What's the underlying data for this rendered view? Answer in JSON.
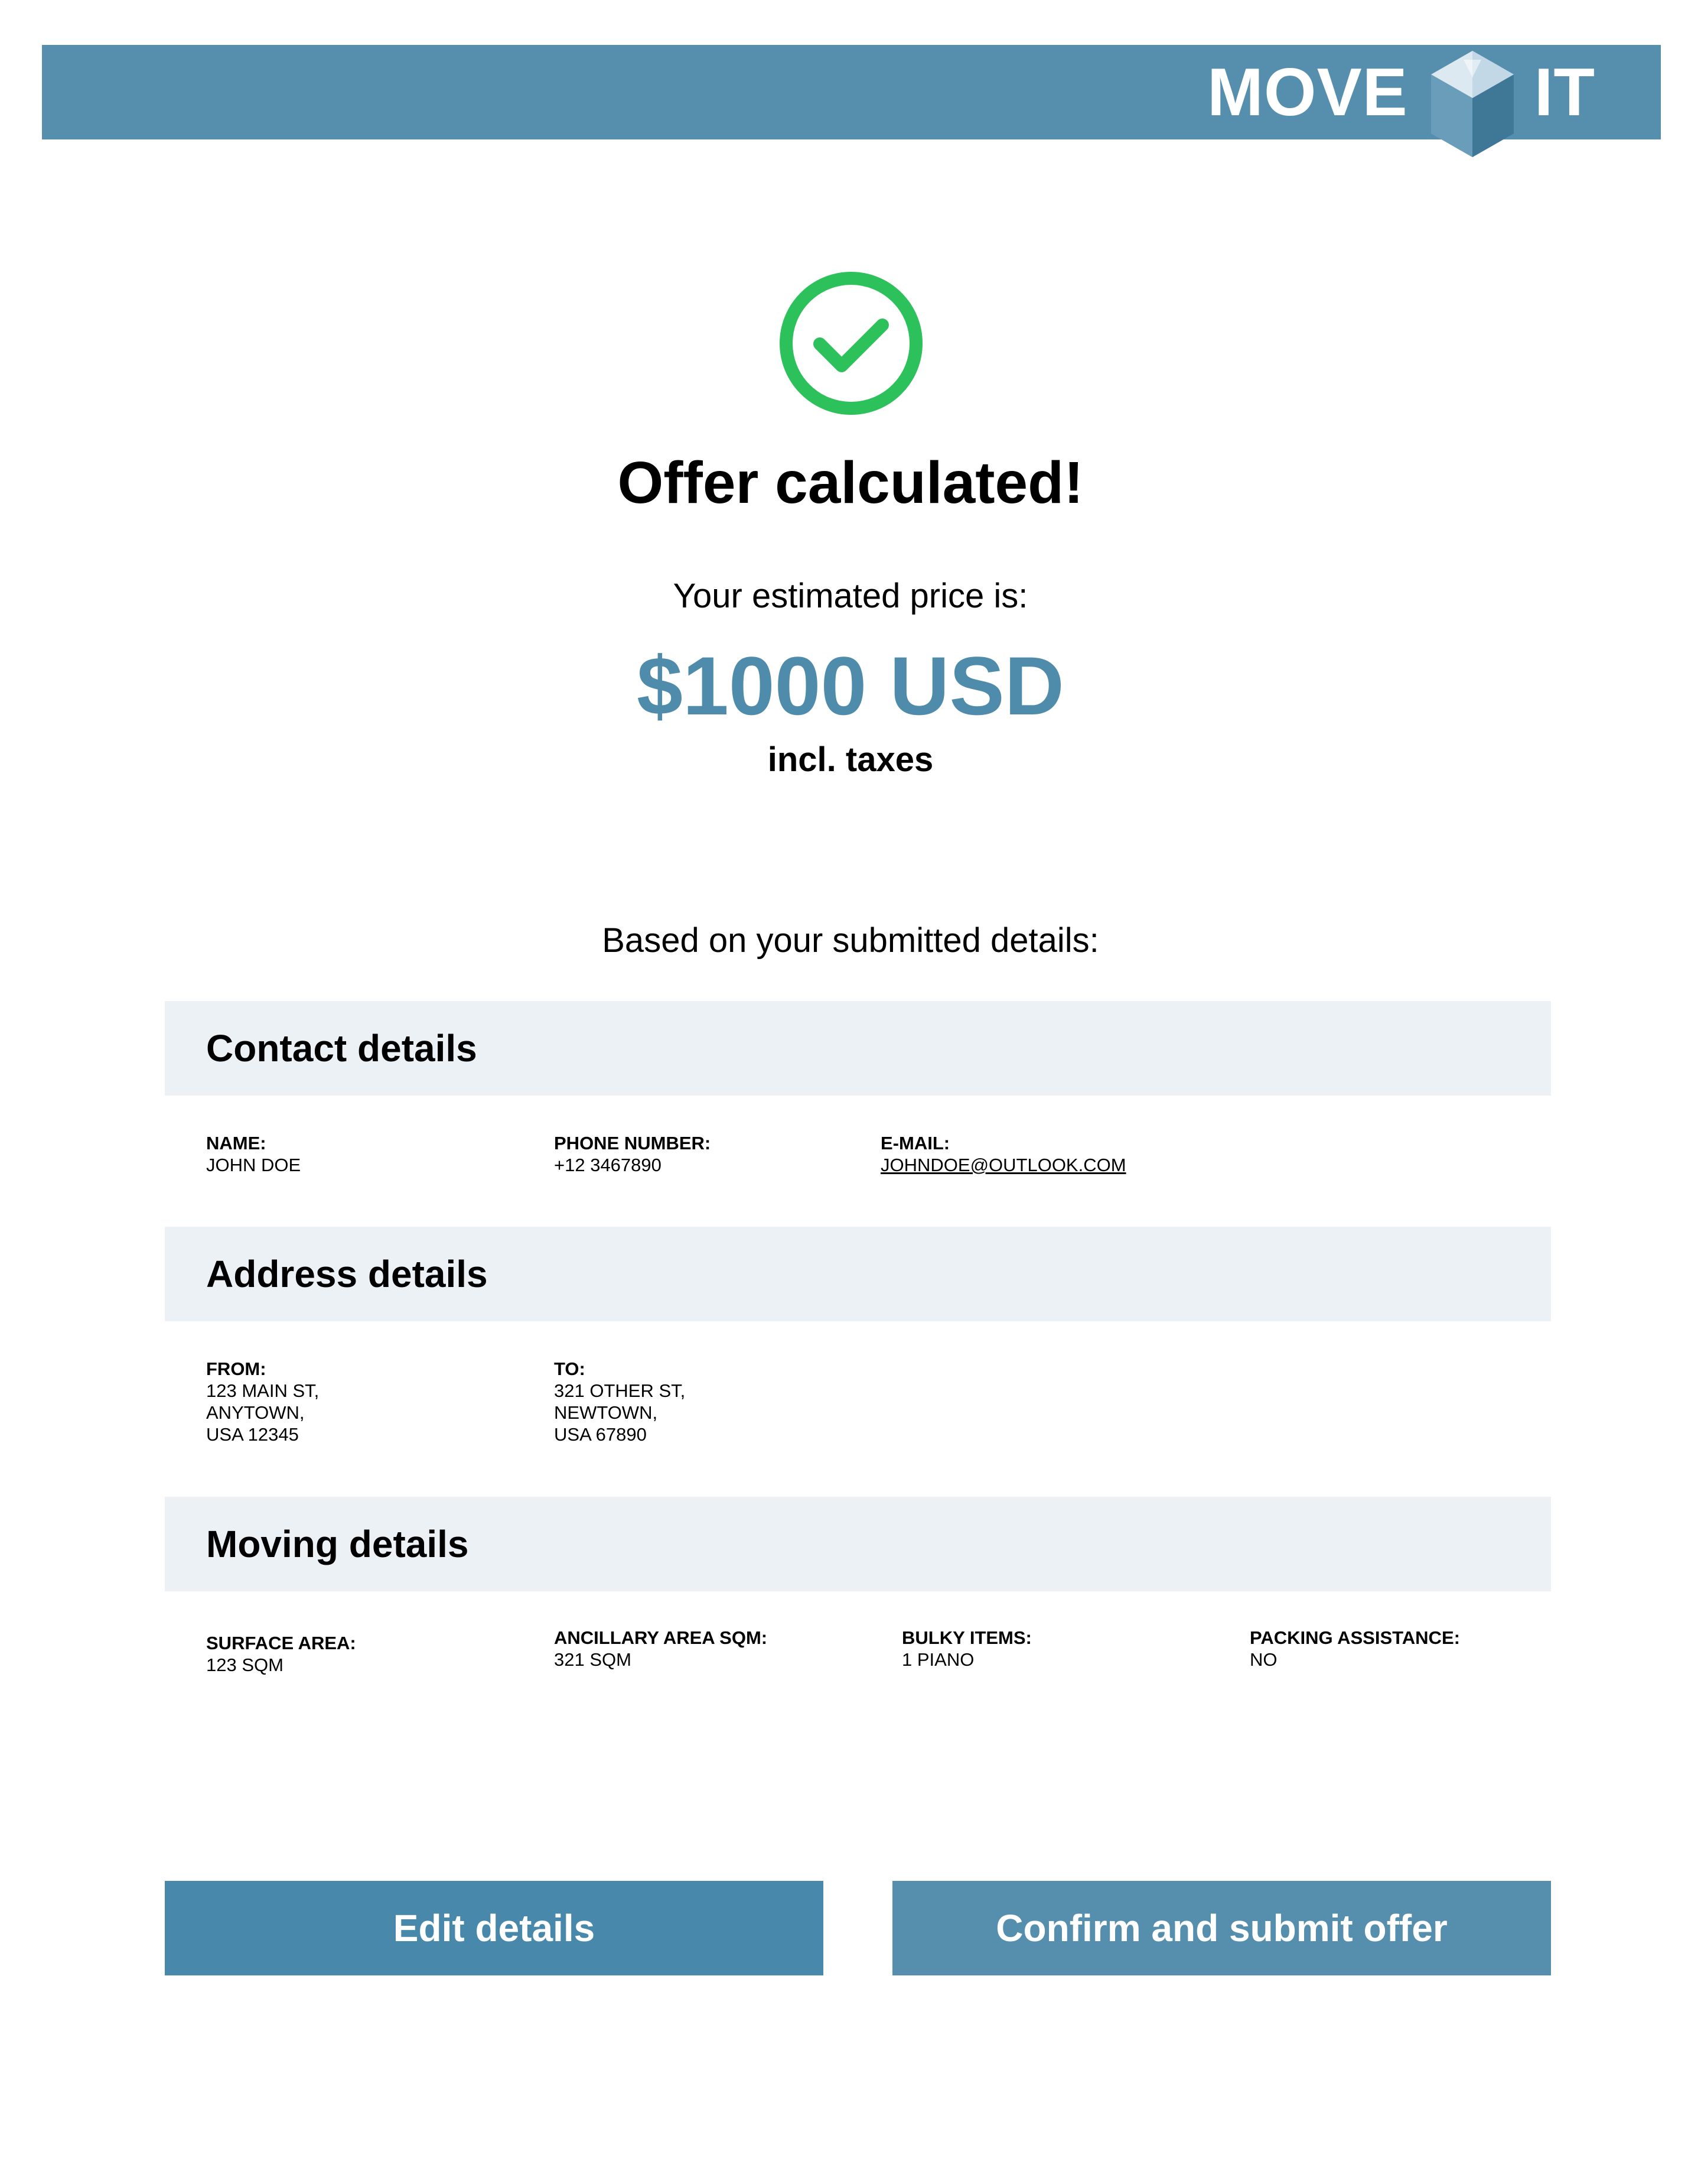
{
  "colors": {
    "brand": "#568fae",
    "price": "#4f8bab",
    "success": "#2dc15b",
    "section_bg": "#ecf1f5"
  },
  "header": {
    "logo_left": "MOVE",
    "logo_right": "IT",
    "logo_icon": "cube-icon"
  },
  "status": {
    "icon": "check-circle-icon",
    "title": "Offer calculated!",
    "subtitle": "Your estimated price is:",
    "price": "$1000 USD",
    "tax_note": "incl. taxes",
    "based_on": "Based on your submitted details:"
  },
  "contact": {
    "heading": "Contact details",
    "name_label": "NAME:",
    "name_value": "JOHN DOE",
    "phone_label": "PHONE NUMBER:",
    "phone_value": "+12 3467890",
    "email_label": "E-MAIL:",
    "email_value": "JOHNDOE@OUTLOOK.COM"
  },
  "address": {
    "heading": "Address details",
    "from_label": "FROM:",
    "from_value": "123 MAIN ST,\nANYTOWN,\nUSA 12345",
    "to_label": "TO:",
    "to_value": "321 OTHER ST,\nNEWTOWN,\nUSA 67890"
  },
  "moving": {
    "heading": "Moving details",
    "surface_label": "SURFACE AREA:",
    "surface_value": "123 SQM",
    "ancillary_label": "ANCILLARY AREA SQM:",
    "ancillary_value": "321 SQM",
    "bulky_label": "BULKY ITEMS:",
    "bulky_value": "1 PIANO",
    "packing_label": "PACKING ASSISTANCE:",
    "packing_value": "NO"
  },
  "actions": {
    "edit_label": "Edit details",
    "confirm_label": "Confirm and submit offer"
  }
}
